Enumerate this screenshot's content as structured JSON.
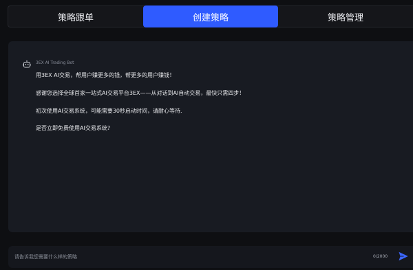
{
  "tabs": [
    {
      "label": "策略跟单",
      "active": false
    },
    {
      "label": "创建策略",
      "active": true
    },
    {
      "label": "策略管理",
      "active": false
    }
  ],
  "chat": {
    "bot_name": "3EX AI Trading Bot",
    "bot_icon": "robot-icon",
    "messages": [
      "用3EX AI交易，帮用户赚更多的钱，帮更多的用户赚钱！",
      "感谢您选择全球首家一站式AI交易平台3EX——从对话到AI自动交易，最快只需四步！",
      "初次使用AI交易系统，可能需要30秒启动时间，请耐心等待.",
      "是否立即免费使用AI交易系统?"
    ]
  },
  "input": {
    "placeholder": "请告诉我您需要什么样的策略",
    "counter": "0/2000",
    "send_icon": "send-icon"
  },
  "colors": {
    "accent": "#2f5bff",
    "background": "#0e0f12",
    "panel": "#181b22"
  }
}
